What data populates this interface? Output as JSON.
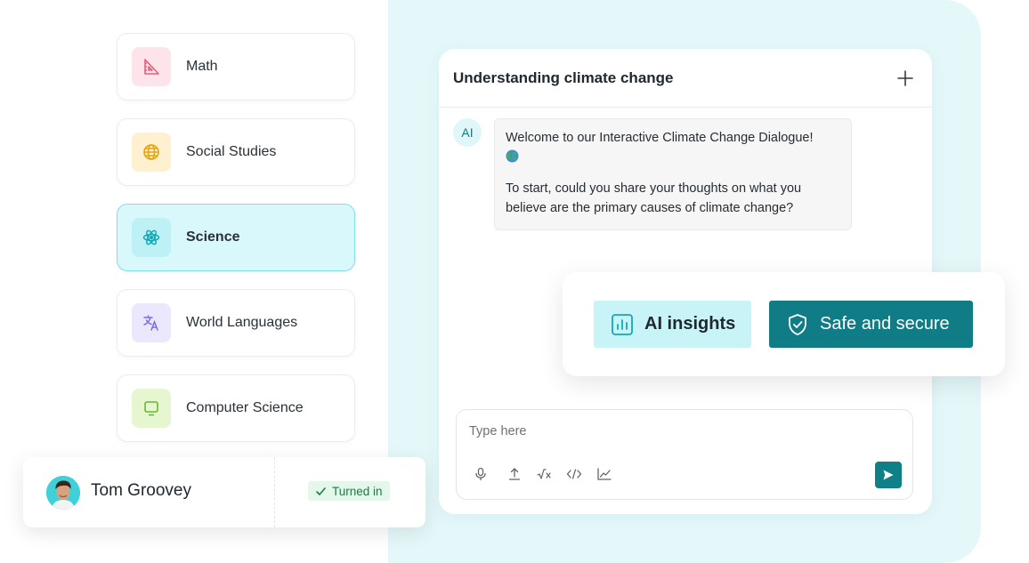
{
  "subjects": [
    {
      "label": "Math",
      "icon": "ruler-triangle-icon",
      "icon_bg": "#fde4ea",
      "icon_color": "#e4607e",
      "active": false
    },
    {
      "label": "Social Studies",
      "icon": "globe-icon",
      "icon_bg": "#fff0cf",
      "icon_color": "#e3a512",
      "active": false
    },
    {
      "label": "Science",
      "icon": "atom-icon",
      "icon_bg": "#bdf1f5",
      "icon_color": "#12a9b6",
      "active": true
    },
    {
      "label": "World Languages",
      "icon": "translate-icon",
      "icon_bg": "#ebe7fc",
      "icon_color": "#7a6be0",
      "active": false
    },
    {
      "label": "Computer Science",
      "icon": "monitor-icon",
      "icon_bg": "#e6f6cf",
      "icon_color": "#6fb23a",
      "active": false
    }
  ],
  "chat": {
    "title": "Understanding climate change",
    "ai_label": "AI",
    "message_line1": "Welcome to our Interactive Climate Change Dialogue!",
    "message_line2": "To start, could you share your thoughts on what you believe are the primary causes of climate change?",
    "input_placeholder": "Type here",
    "tools": [
      "microphone-icon",
      "upload-icon",
      "square-root-icon",
      "code-icon",
      "line-chart-icon"
    ]
  },
  "features": {
    "insights_label": "AI insights",
    "secure_label": "Safe and secure"
  },
  "student": {
    "name": "Tom Groovey",
    "status": "Turned in"
  },
  "colors": {
    "accent": "#0f7c86",
    "background_teal": "#e4f8fa",
    "active_card": "#d9f8fb"
  }
}
